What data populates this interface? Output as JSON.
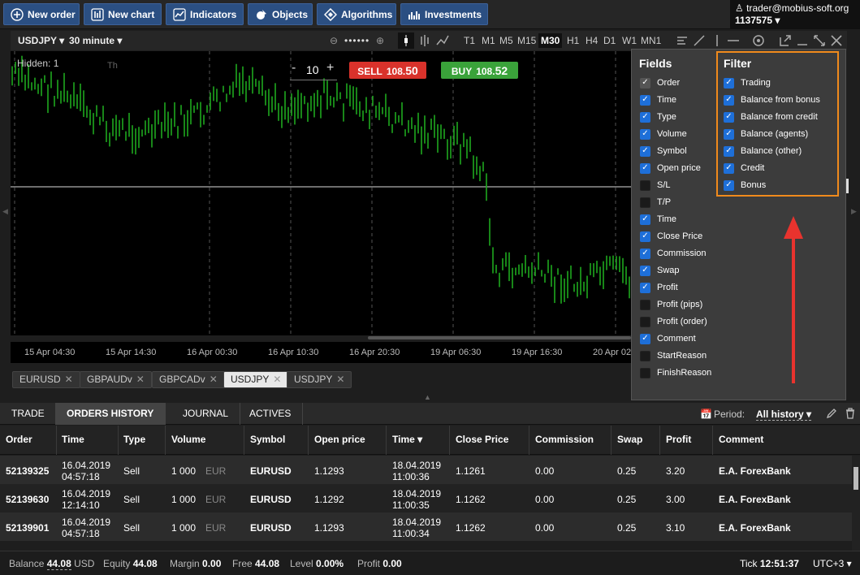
{
  "toolbar": {
    "new_order": "New order",
    "new_chart": "New chart",
    "indicators": "Indicators",
    "objects": "Objects",
    "algorithms": "Algorithms",
    "investments": "Investments"
  },
  "account": {
    "email": "trader@mobius-soft.org",
    "number": "1137575"
  },
  "chart": {
    "symbol": "USDJPY",
    "timeframe": "30 minute",
    "timeframes": [
      "T1",
      "M1",
      "M5",
      "M15",
      "M30",
      "H1",
      "H4",
      "D1",
      "W1",
      "MN1"
    ],
    "active_timeframe": "M30",
    "hidden_label": "Hidden: 1",
    "th_label": "Th",
    "lot": "10",
    "sell_label": "SELL",
    "sell_price_main": "108.",
    "sell_price_big": "50",
    "buy_label": "BUY",
    "buy_price_main": "108.",
    "buy_price_big": "52",
    "x_labels": [
      "15 Apr 04:30",
      "15 Apr 14:30",
      "16 Apr 00:30",
      "16 Apr 10:30",
      "16 Apr 20:30",
      "19 Apr 06:30",
      "19 Apr 16:30",
      "20 Apr 02"
    ],
    "colors": {
      "candle": "#1fa81f",
      "sell": "#d9322b",
      "buy": "#3aa33a"
    }
  },
  "symbol_tabs": [
    "EURUSD",
    "GBPAUDv",
    "GBPCADv",
    "USDJPY",
    "USDJPY"
  ],
  "active_symbol_tab": 3,
  "fields_panel": {
    "fields_title": "Fields",
    "filter_title": "Filter",
    "fields": [
      {
        "label": "Order",
        "checked": "gray"
      },
      {
        "label": "Time",
        "checked": true
      },
      {
        "label": "Type",
        "checked": true
      },
      {
        "label": "Volume",
        "checked": true
      },
      {
        "label": "Symbol",
        "checked": true
      },
      {
        "label": "Open price",
        "checked": true
      },
      {
        "label": "S/L",
        "checked": false
      },
      {
        "label": "T/P",
        "checked": false
      },
      {
        "label": "Time",
        "checked": true
      },
      {
        "label": "Close Price",
        "checked": true
      },
      {
        "label": "Commission",
        "checked": true
      },
      {
        "label": "Swap",
        "checked": true
      },
      {
        "label": "Profit",
        "checked": true
      },
      {
        "label": "Profit (pips)",
        "checked": false
      },
      {
        "label": "Profit (order)",
        "checked": false
      },
      {
        "label": "Comment",
        "checked": true
      },
      {
        "label": "StartReason",
        "checked": false
      },
      {
        "label": "FinishReason",
        "checked": false
      }
    ],
    "filters": [
      {
        "label": "Trading",
        "checked": true
      },
      {
        "label": "Balance from bonus",
        "checked": true
      },
      {
        "label": "Balance from credit",
        "checked": true
      },
      {
        "label": "Balance (agents)",
        "checked": true
      },
      {
        "label": "Balance (other)",
        "checked": true
      },
      {
        "label": "Credit",
        "checked": true
      },
      {
        "label": "Bonus",
        "checked": true
      }
    ],
    "colors": {
      "highlight": "#f08a1c",
      "arrow": "#e8332e"
    }
  },
  "bottom_tabs": [
    "TRADE",
    "ORDERS HISTORY",
    "JOURNAL",
    "ACTIVES"
  ],
  "active_bottom_tab": 1,
  "period": {
    "label": "Period:",
    "value": "All history"
  },
  "table": {
    "headers": [
      "Order",
      "Time",
      "Type",
      "Volume",
      "Symbol",
      "Open price",
      "Time ▾",
      "Close Price",
      "Commission",
      "Swap",
      "Profit",
      "Comment"
    ],
    "rows": [
      {
        "order": "52139325",
        "time1": "16.04.2019",
        "time2": "04:57:18",
        "type": "Sell",
        "volume": "1 000",
        "unit": "EUR",
        "symbol": "EURUSD",
        "open": "1.1293",
        "ctime1": "18.04.2019",
        "ctime2": "11:00:36",
        "close": "1.1261",
        "commission": "0.00",
        "swap": "0.25",
        "profit": "3.20",
        "comment": "E.A. ForexBank"
      },
      {
        "order": "52139630",
        "time1": "16.04.2019",
        "time2": "12:14:10",
        "type": "Sell",
        "volume": "1 000",
        "unit": "EUR",
        "symbol": "EURUSD",
        "open": "1.1292",
        "ctime1": "18.04.2019",
        "ctime2": "11:00:35",
        "close": "1.1262",
        "commission": "0.00",
        "swap": "0.25",
        "profit": "3.00",
        "comment": "E.A. ForexBank"
      },
      {
        "order": "52139901",
        "time1": "16.04.2019",
        "time2": "04:57:18",
        "type": "Sell",
        "volume": "1 000",
        "unit": "EUR",
        "symbol": "EURUSD",
        "open": "1.1293",
        "ctime1": "18.04.2019",
        "ctime2": "11:00:34",
        "close": "1.1262",
        "commission": "0.00",
        "swap": "0.25",
        "profit": "3.10",
        "comment": "E.A. ForexBank"
      }
    ]
  },
  "status": {
    "balance_label": "Balance",
    "balance": "44.08",
    "balance_cur": "USD",
    "equity_label": "Equity",
    "equity": "44.08",
    "margin_label": "Margin",
    "margin": "0.00",
    "free_label": "Free",
    "free": "44.08",
    "level_label": "Level",
    "level": "0.00%",
    "profit_label": "Profit",
    "profit": "0.00",
    "tick_label": "Tick",
    "tick": "12:51:37",
    "timezone": "UTC+3"
  }
}
